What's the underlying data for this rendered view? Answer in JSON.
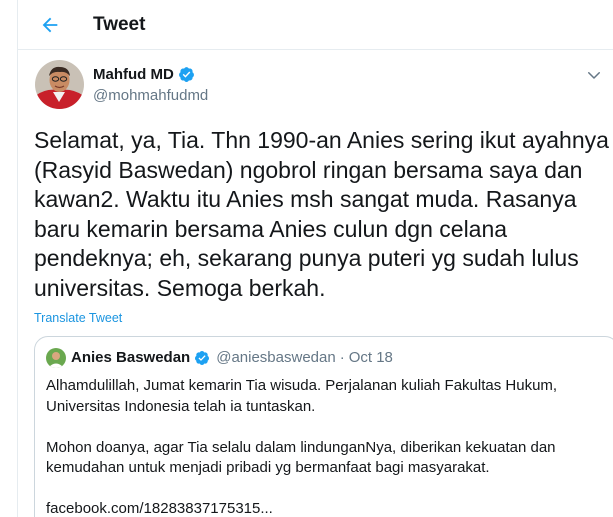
{
  "header": {
    "title": "Tweet",
    "back_icon": "arrow-left-icon",
    "accent": "#1da1f2"
  },
  "tweet": {
    "author_name": "Mahfud MD",
    "author_handle": "@mohmahfudmd",
    "verified_icon": "verified-badge-icon",
    "menu_icon": "chevron-down-icon",
    "text": "Selamat, ya, Tia. Thn 1990-an Anies sering ikut ayahnya (Rasyid Baswedan) ngobrol ringan bersama saya dan kawan2. Waktu itu Anies msh sangat muda. Rasanya baru kemarin bersama Anies culun dgn celana pendeknya; eh, sekarang punya puteri yg sudah lulus universitas. Semoga berkah.",
    "translate_label": "Translate Tweet"
  },
  "quote": {
    "author_name": "Anies Baswedan",
    "author_handle": "@aniesbaswedan",
    "separator": "·",
    "date": "Oct 18",
    "line1": "Alhamdulillah, Jumat kemarin Tia wisuda. Perjalanan kuliah Fakultas Hukum,",
    "line2": "Universitas Indonesia telah ia tuntaskan.",
    "line3": "Mohon doanya, agar Tia selalu dalam lindunganNya, diberikan kekuatan dan",
    "line4": "kemudahan untuk menjadi pribadi yg bermanfaat bagi masyarakat.",
    "link": "facebook.com/18283837175315..."
  }
}
